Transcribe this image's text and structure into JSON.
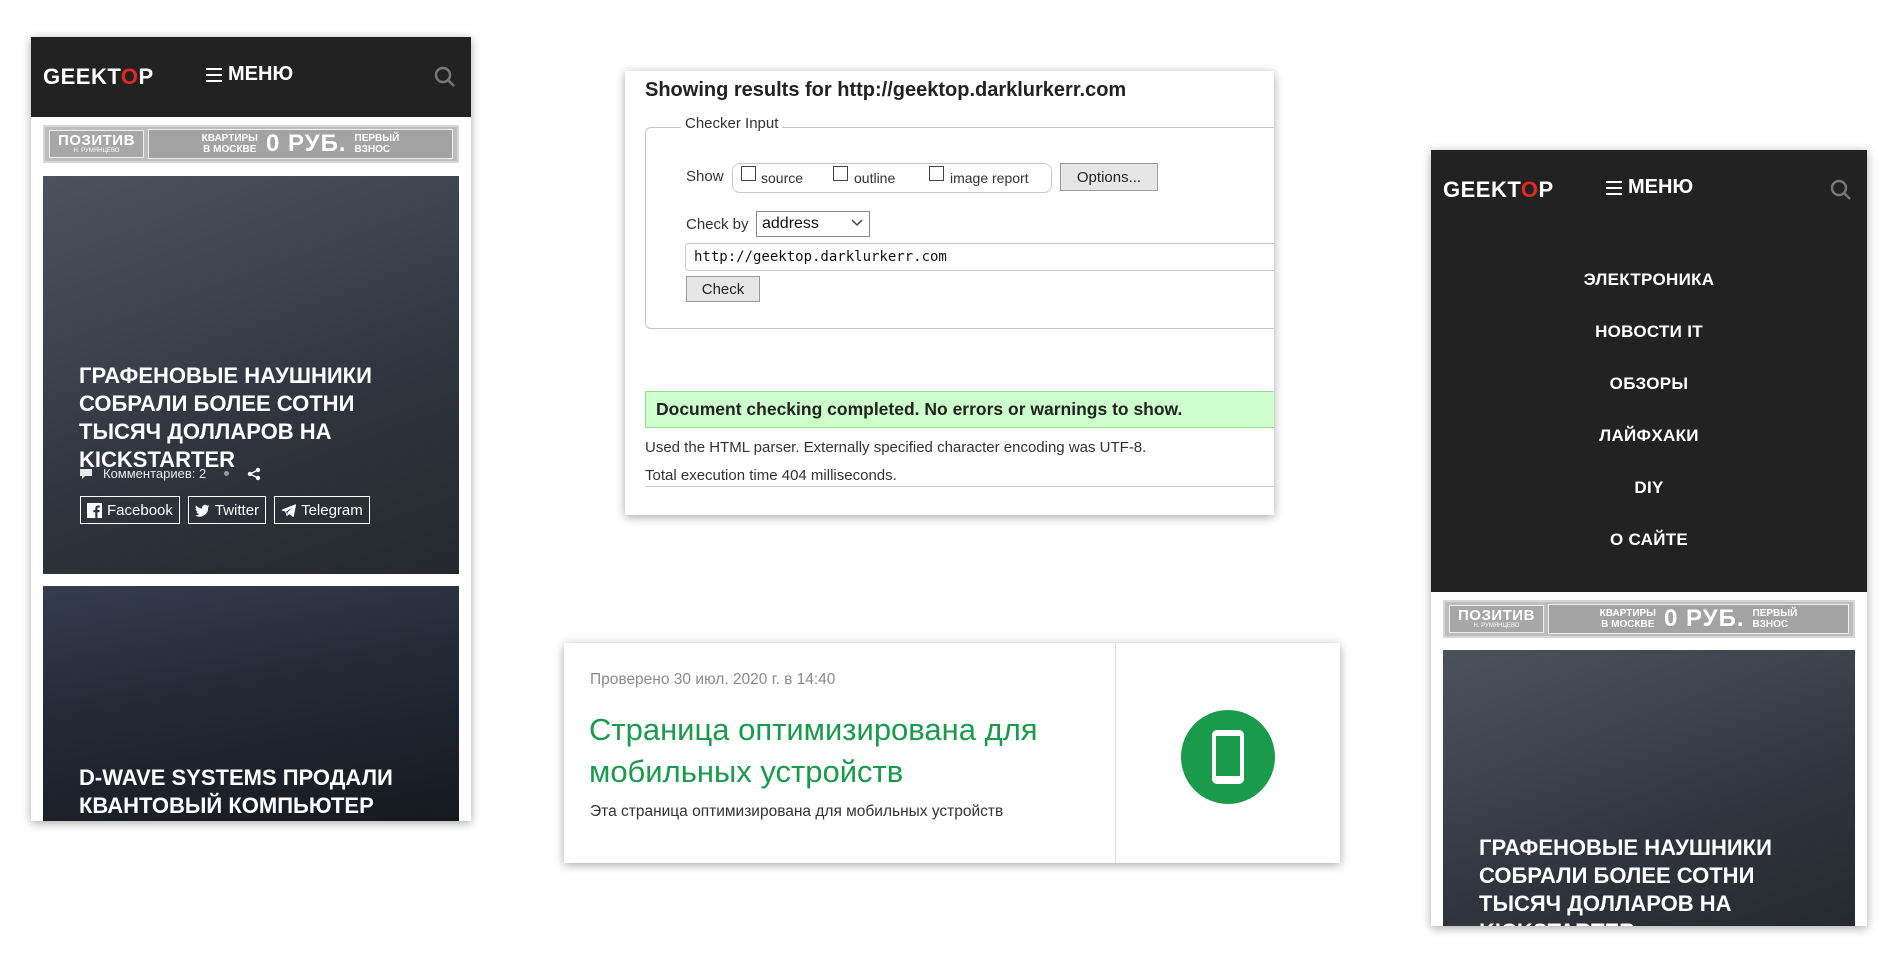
{
  "left_phone": {
    "header": {
      "logo_main": "GEEKT",
      "logo_accent": "O",
      "logo_end": "P",
      "menu_label": "МЕНЮ"
    },
    "ad": {
      "brand": "ПОЗИТИВ",
      "brand_sub": "Н. РУМЯНЦЕВО",
      "text_left": "КВАРТИРЫ\nВ МОСКВЕ",
      "text_big": "0 РУБ.",
      "text_right": "ПЕРВЫЙ\nВЗНОС"
    },
    "article1": {
      "title": "ГРАФЕНОВЫЕ НАУШНИКИ СОБРАЛИ БОЛЕЕ СОТНИ ТЫСЯЧ ДОЛЛАРОВ НА KICKSTARTER",
      "comments": "Комментариев: 2",
      "share": [
        "Facebook",
        "Twitter",
        "Telegram"
      ]
    },
    "article2": {
      "title": "D-WAVE SYSTEMS ПРОДАЛИ КВАНТОВЫЙ КОМПЬЮТЕР"
    }
  },
  "validator": {
    "title": "Showing results for http://geektop.darklurkerr.com",
    "legend": "Checker Input",
    "show_label": "Show",
    "checkboxes": [
      "source",
      "outline",
      "image report"
    ],
    "options_btn": "Options...",
    "check_by_label": "Check by",
    "check_by_value": "address",
    "url_value": "http://geektop.darklurkerr.com",
    "check_btn": "Check",
    "success_msg": "Document checking completed. No errors or warnings to show.",
    "info1": "Used the HTML parser. Externally specified character encoding was UTF-8.",
    "info2": "Total execution time 404 milliseconds."
  },
  "mobile_friendly": {
    "date": "Проверено 30 июл. 2020 г. в 14:40",
    "heading": "Страница оптимизирована для мобильных устройств",
    "sub": "Эта страница оптимизирована для мобильных устройств",
    "accent": "#1a9a4b"
  },
  "right_phone": {
    "header": {
      "logo_main": "GEEKT",
      "logo_accent": "O",
      "logo_end": "P",
      "menu_label": "МЕНЮ"
    },
    "nav": [
      "ЭЛЕКТРОНИКА",
      "НОВОСТИ IT",
      "ОБЗОРЫ",
      "ЛАЙФХАКИ",
      "DIY",
      "О САЙТЕ"
    ],
    "ad": {
      "brand": "ПОЗИТИВ",
      "brand_sub": "Н. РУМЯНЦЕВО",
      "text_left": "КВАРТИРЫ\nВ МОСКВЕ",
      "text_big": "0 РУБ.",
      "text_right": "ПЕРВЫЙ\nВЗНОС"
    },
    "article1": {
      "title": "ГРАФЕНОВЫЕ НАУШНИКИ СОБРАЛИ БОЛЕЕ СОТНИ ТЫСЯЧ ДОЛЛАРОВ НА KICKSTARTER"
    }
  }
}
